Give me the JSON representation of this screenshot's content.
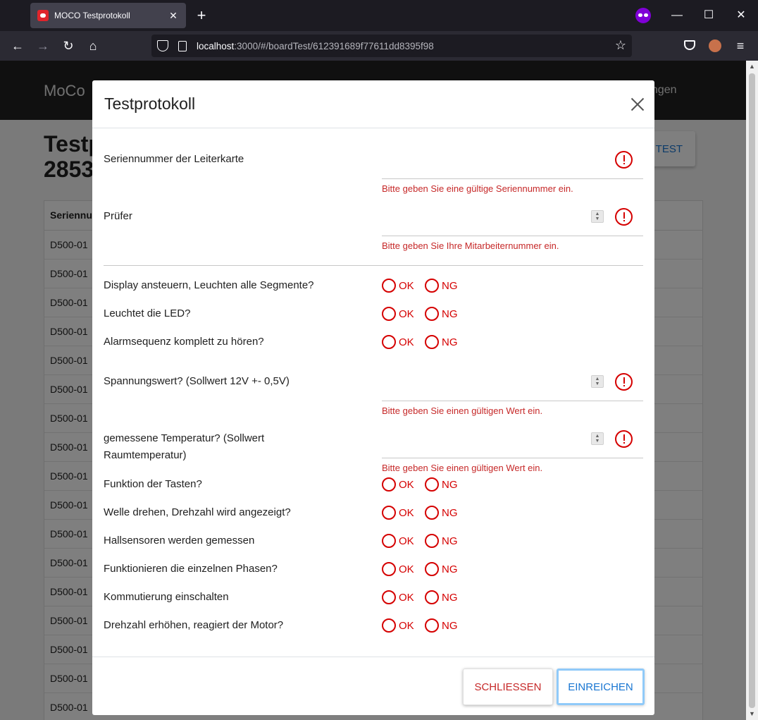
{
  "browser": {
    "tab_title": "MOCO Testprotokoll",
    "url_host": "localhost",
    "url_rest": ":3000/#/boardTest/612391689f77611dd8395f98"
  },
  "app": {
    "brand": "MoCo",
    "nav_settings": "ellungen",
    "page_title_line1": "Testp",
    "page_title_line2": "2853",
    "new_test_label": "TEST",
    "table_header": "Seriennu",
    "table_rows": [
      "D500-01",
      "D500-01",
      "D500-01",
      "D500-01",
      "D500-01",
      "D500-01",
      "D500-01",
      "D500-01",
      "D500-01",
      "D500-01",
      "D500-01",
      "D500-01",
      "D500-01",
      "D500-01",
      "D500-01",
      "D500-01",
      "D500-01"
    ]
  },
  "modal": {
    "title": "Testprotokoll",
    "fields": {
      "serial": {
        "label": "Seriennummer der Leiterkarte",
        "error": "Bitte geben Sie eine gültige Seriennummer ein."
      },
      "tester": {
        "label": "Prüfer",
        "error": "Bitte geben Sie Ihre Mitarbeiternummer ein."
      },
      "voltage": {
        "label": "Spannungswert? (Sollwert 12V +- 0,5V)",
        "error": "Bitte geben Sie einen gültigen Wert ein."
      },
      "temperature": {
        "label_line1": "gemessene Temperatur? (Sollwert",
        "label_line2": "Raumtemperatur)",
        "error": "Bitte geben Sie einen gültigen Wert ein."
      }
    },
    "checks_a": [
      {
        "label": "Display ansteuern, Leuchten alle Segmente?",
        "ok": "OK",
        "ng": "NG"
      },
      {
        "label": "Leuchtet die LED?",
        "ok": "OK",
        "ng": "NG"
      },
      {
        "label": "Alarmsequenz komplett zu hören?",
        "ok": "OK",
        "ng": "NG"
      }
    ],
    "checks_b": [
      {
        "label": "Funktion der Tasten?",
        "ok": "OK",
        "ng": "NG"
      },
      {
        "label": "Welle drehen, Drehzahl wird angezeigt?",
        "ok": "OK",
        "ng": "NG"
      },
      {
        "label": "Hallsensoren werden gemessen",
        "ok": "OK",
        "ng": "NG"
      },
      {
        "label": "Funktionieren die einzelnen Phasen?",
        "ok": "OK",
        "ng": "NG"
      },
      {
        "label": "Kommutierung einschalten",
        "ok": "OK",
        "ng": "NG"
      },
      {
        "label": "Drehzahl erhöhen, reagiert der Motor?",
        "ok": "OK",
        "ng": "NG"
      }
    ],
    "close_label": "SCHLIESSEN",
    "submit_label": "EINREICHEN"
  },
  "colors": {
    "error": "#d50000",
    "primary": "#1976d2"
  }
}
